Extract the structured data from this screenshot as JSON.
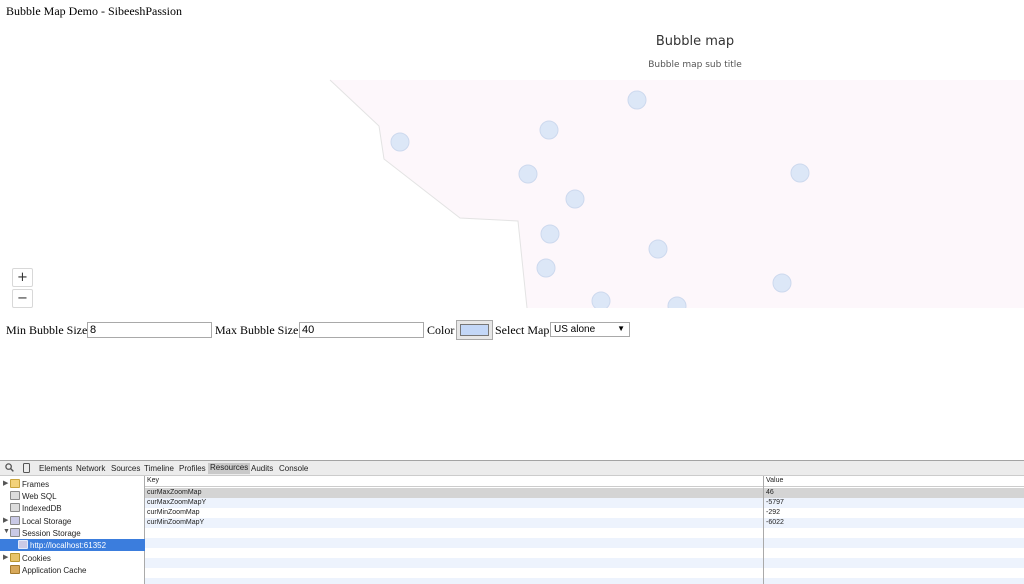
{
  "page": {
    "title": "Bubble Map Demo - SibeeshPassion"
  },
  "map": {
    "title": "Bubble map",
    "subtitle": "Bubble map sub title",
    "bubble_color": "#dce7f7",
    "land_color": "#fdf7fb",
    "zoom_in_label": "+",
    "zoom_out_label": "−"
  },
  "controls": {
    "min_label": "Min Bubble Size",
    "min_value": "8",
    "max_label": "Max Bubble Size",
    "max_value": "40",
    "color_label": "Color",
    "color_value": "#c3d7f7",
    "map_label": "Select Map",
    "map_value": "US alone"
  },
  "devtools": {
    "tabs": [
      "Elements",
      "Network",
      "Sources",
      "Timeline",
      "Profiles",
      "Resources",
      "Audits",
      "Console"
    ],
    "active_tab": "Resources",
    "tree": [
      {
        "label": "Frames",
        "icon": "folder-icon"
      },
      {
        "label": "Web SQL",
        "icon": "database-icon"
      },
      {
        "label": "IndexedDB",
        "icon": "database-icon"
      },
      {
        "label": "Local Storage",
        "icon": "storage-icon"
      },
      {
        "label": "Session Storage",
        "icon": "storage-icon"
      },
      {
        "label": "http://localhost:61352",
        "icon": "storage-icon"
      },
      {
        "label": "Cookies",
        "icon": "cookie-icon"
      },
      {
        "label": "Application Cache",
        "icon": "cache-icon"
      }
    ],
    "table": {
      "key_header": "Key",
      "value_header": "Value",
      "rows": [
        {
          "key": "curMaxZoomMap",
          "value": "46"
        },
        {
          "key": "curMaxZoomMapY",
          "value": "-5797"
        },
        {
          "key": "curMinZoomMap",
          "value": "-292"
        },
        {
          "key": "curMinZoomMapY",
          "value": "-6022"
        }
      ]
    }
  }
}
